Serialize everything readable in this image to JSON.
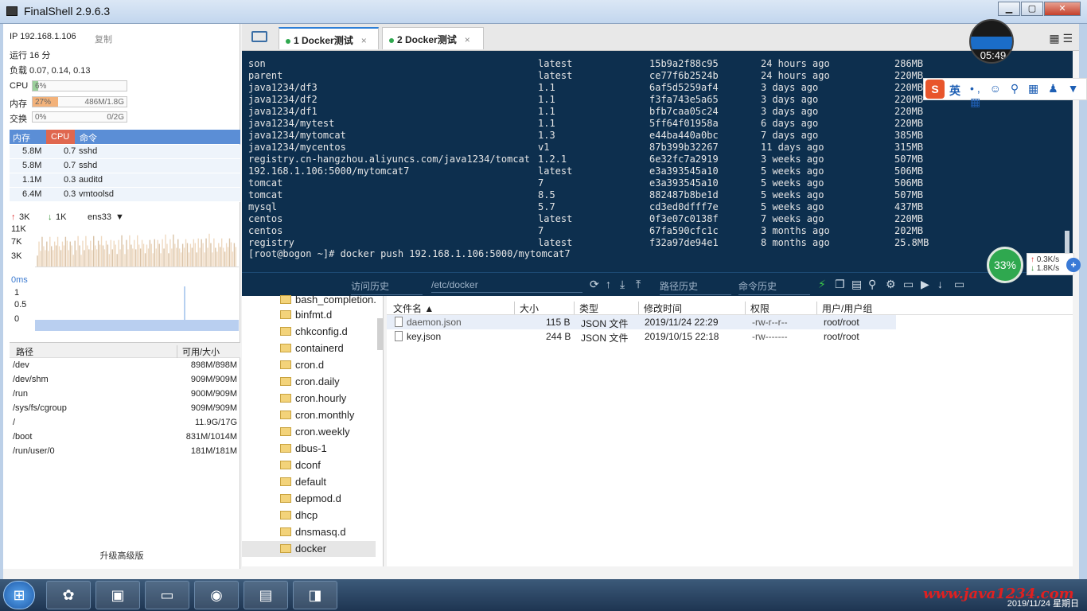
{
  "window": {
    "title": "FinalShell 2.9.6.3",
    "buttons": {
      "minimize": "▁",
      "maximize": "▢",
      "close": "✕"
    }
  },
  "sidebar": {
    "ip": "IP 192.168.1.106",
    "copy_label": "复制",
    "uptime": "运行 16 分",
    "load": "负载 0.07, 0.14, 0.13",
    "cpu": {
      "label": "CPU",
      "pct_text": "6%",
      "fraction": 0.06,
      "color": "#9bd09b"
    },
    "mem": {
      "label": "内存",
      "pct_text": "27%",
      "fraction": 0.27,
      "detail": "486M/1.8G",
      "color": "#f3b27a"
    },
    "swap": {
      "label": "交换",
      "pct_text": "0%",
      "fraction": 0,
      "detail": "0/2G"
    },
    "proc_headers": {
      "mem": "内存",
      "cpu": "CPU",
      "cmd": "命令"
    },
    "processes": [
      {
        "mem": "5.8M",
        "cpu": "0.7",
        "cmd": "sshd"
      },
      {
        "mem": "5.8M",
        "cpu": "0.7",
        "cmd": "sshd"
      },
      {
        "mem": "1.1M",
        "cpu": "0.3",
        "cmd": "auditd"
      },
      {
        "mem": "6.4M",
        "cpu": "0.3",
        "cmd": "vmtoolsd"
      }
    ],
    "net": {
      "up": "3K",
      "down": "1K",
      "iface": "ens33",
      "y_ticks": [
        "11K",
        "7K",
        "3K"
      ]
    },
    "latency": {
      "label": "0ms",
      "y_ticks": [
        "1",
        "0.5",
        "0"
      ]
    },
    "disk_headers": {
      "path": "路径",
      "size": "可用/大小"
    },
    "disks": [
      {
        "path": "/dev",
        "size": "898M/898M"
      },
      {
        "path": "/dev/shm",
        "size": "909M/909M"
      },
      {
        "path": "/run",
        "size": "900M/909M"
      },
      {
        "path": "/sys/fs/cgroup",
        "size": "909M/909M"
      },
      {
        "path": "/",
        "size": "11.9G/17G"
      },
      {
        "path": "/boot",
        "size": "831M/1014M"
      },
      {
        "path": "/run/user/0",
        "size": "181M/181M"
      }
    ],
    "upgrade": "升级高级版"
  },
  "tabs": [
    {
      "label": "1 Docker测试",
      "close": "×"
    },
    {
      "label": "2 Docker测试",
      "close": "×"
    }
  ],
  "terminal": {
    "rows": [
      {
        "repo": "son",
        "tag": "latest",
        "id": "15b9a2f88c95",
        "created": "24 hours ago",
        "size": "286MB"
      },
      {
        "repo": "parent",
        "tag": "latest",
        "id": "ce77f6b2524b",
        "created": "24 hours ago",
        "size": "220MB"
      },
      {
        "repo": "java1234/df3",
        "tag": "1.1",
        "id": "6af5d5259af4",
        "created": "3 days ago",
        "size": "220MB"
      },
      {
        "repo": "java1234/df2",
        "tag": "1.1",
        "id": "f3fa743e5a65",
        "created": "3 days ago",
        "size": "220MB"
      },
      {
        "repo": "java1234/df1",
        "tag": "1.1",
        "id": "bfb7caa05c24",
        "created": "3 days ago",
        "size": "220MB"
      },
      {
        "repo": "java1234/mytest",
        "tag": "1.1",
        "id": "5ff64f01958a",
        "created": "6 days ago",
        "size": "220MB"
      },
      {
        "repo": "java1234/mytomcat",
        "tag": "1.3",
        "id": "e44ba440a0bc",
        "created": "7 days ago",
        "size": "385MB"
      },
      {
        "repo": "java1234/mycentos",
        "tag": "v1",
        "id": "87b399b32267",
        "created": "11 days ago",
        "size": "315MB"
      },
      {
        "repo": "registry.cn-hangzhou.aliyuncs.com/java1234/tomcat",
        "tag": "1.2.1",
        "id": "6e32fc7a2919",
        "created": "3 weeks ago",
        "size": "507MB"
      },
      {
        "repo": "192.168.1.106:5000/mytomcat7",
        "tag": "latest",
        "id": "e3a393545a10",
        "created": "5 weeks ago",
        "size": "506MB"
      },
      {
        "repo": "tomcat",
        "tag": "7",
        "id": "e3a393545a10",
        "created": "5 weeks ago",
        "size": "506MB"
      },
      {
        "repo": "tomcat",
        "tag": "8.5",
        "id": "882487b8be1d",
        "created": "5 weeks ago",
        "size": "507MB"
      },
      {
        "repo": "mysql",
        "tag": "5.7",
        "id": "cd3ed0dfff7e",
        "created": "5 weeks ago",
        "size": "437MB"
      },
      {
        "repo": "centos",
        "tag": "latest",
        "id": "0f3e07c0138f",
        "created": "7 weeks ago",
        "size": "220MB"
      },
      {
        "repo": "centos",
        "tag": "7",
        "id": "67fa590cfc1c",
        "created": "3 months ago",
        "size": "202MB"
      },
      {
        "repo": "registry",
        "tag": "latest",
        "id": "f32a97de94e1",
        "created": "8 months ago",
        "size": "25.8MB"
      }
    ],
    "prompt": "[root@bogon ~]# docker push 192.168.1.106:5000/mytomcat7"
  },
  "termbar": {
    "history": "访问历史",
    "path": "/etc/docker",
    "path_history": "路径历史",
    "cmd_history": "命令历史"
  },
  "tree": {
    "items": [
      "bash_completion.",
      "binfmt.d",
      "chkconfig.d",
      "containerd",
      "cron.d",
      "cron.daily",
      "cron.hourly",
      "cron.monthly",
      "cron.weekly",
      "dbus-1",
      "dconf",
      "default",
      "depmod.d",
      "dhcp",
      "dnsmasq.d",
      "docker"
    ]
  },
  "files": {
    "headers": {
      "name": "文件名",
      "size": "大小",
      "type": "类型",
      "mtime": "修改时间",
      "perm": "权限",
      "owner": "用户/用户组"
    },
    "rows": [
      {
        "name": "daemon.json",
        "size": "115 B",
        "type": "JSON 文件",
        "mtime": "2019/11/24 22:29",
        "perm": "-rw-r--r--",
        "owner": "root/root"
      },
      {
        "name": "key.json",
        "size": "244 B",
        "type": "JSON 文件",
        "mtime": "2019/10/15 22:18",
        "perm": "-rw-------",
        "owner": "root/root"
      }
    ]
  },
  "widgets": {
    "clock": "05:49",
    "ime": {
      "logo": "S",
      "lang": "英",
      "glyphs": "•, ☺ ⚲ ▦ ♟ ▼ ▦"
    },
    "netmon": {
      "pct": "33%",
      "up": "0.3K/s",
      "down": "1.8K/s",
      "plus": "+"
    }
  },
  "taskbar": {
    "start": "⊞",
    "watermark": "www.java1234.com",
    "date": "2019/11/24 星期日"
  }
}
